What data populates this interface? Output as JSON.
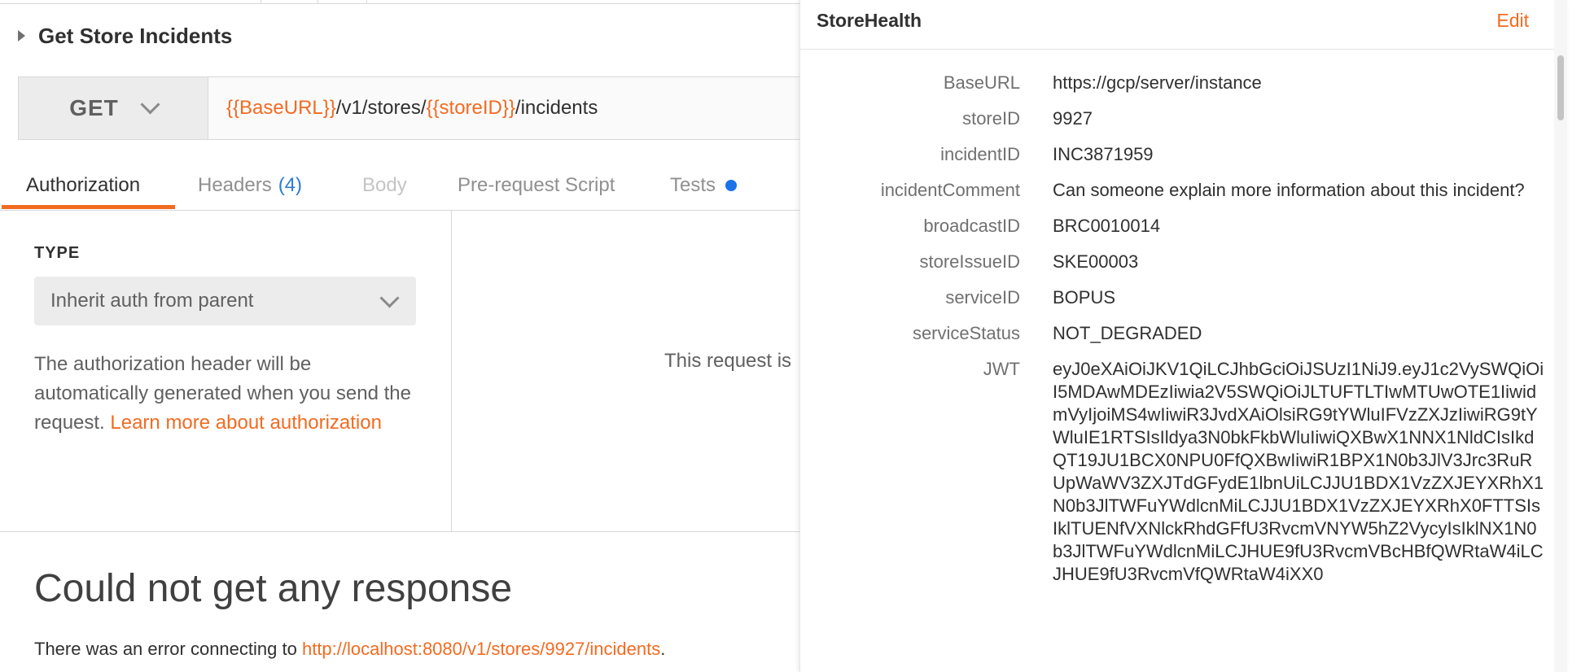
{
  "request": {
    "title": "Get Store Incidents",
    "method": "GET",
    "url_parts": {
      "var1": "{{BaseURL}}",
      "mid": "/v1/stores/",
      "var2": "{{storeID}}",
      "tail": "/incidents"
    }
  },
  "tabs": {
    "authorization": "Authorization",
    "headers": "Headers",
    "headers_count": "(4)",
    "body": "Body",
    "prerequest": "Pre-request Script",
    "tests": "Tests"
  },
  "auth": {
    "type_label": "TYPE",
    "type_value": "Inherit auth from parent",
    "description": "The authorization header will be automatically generated when you send the request.",
    "learn_more": "Learn more about authorization",
    "inherit_message": "This request is"
  },
  "response": {
    "heading": "Could not get any response",
    "error_prefix": "There was an error connecting to",
    "error_url": "http://localhost:8080/v1/stores/9927/incidents",
    "error_suffix": "."
  },
  "environment": {
    "name": "StoreHealth",
    "edit_label": "Edit",
    "variables": [
      {
        "key": "BaseURL",
        "value": "https://gcp/server/instance"
      },
      {
        "key": "storeID",
        "value": "9927"
      },
      {
        "key": "incidentID",
        "value": "INC3871959"
      },
      {
        "key": "incidentComment",
        "value": "Can someone explain more information about this incident?"
      },
      {
        "key": "broadcastID",
        "value": "BRC0010014"
      },
      {
        "key": "storeIssueID",
        "value": "SKE00003"
      },
      {
        "key": "serviceID",
        "value": "BOPUS"
      },
      {
        "key": "serviceStatus",
        "value": "NOT_DEGRADED"
      },
      {
        "key": "JWT",
        "value": "eyJ0eXAiOiJKV1QiLCJhbGciOiJSUzI1NiJ9.eyJ1c2VySWQiOiI5MDAwMDEzIiwia2V5SWQiOiJLTUFTLTIwMTUwOTE1IiwidmVyIjoiMS4wIiwiR3JvdXAiOlsiRG9tYWluIFVzZXJzIiwiRG9tYWluIE1RTSIsIldya3N0bkFkbWluIiwiQXBwX1NNX1NldCIsIkdQT19JU1BCX0NPU0FfQXBwIiwiR1BPX1N0b3JlV3Jrc3RuRUpWaWV3ZXJTdGFydE1lbnUiLCJJU1BDX1VzZXJEYXRhX1N0b3JlTWFuYWdlcnMiLCJJU1BDX1VzZXJEYXRhX0FTTSIsIklTUENfVXNlckRhdGFfU3RvcmVNYW5hZ2VycyIsIklNX1N0b3JlTWFuYWdlcnMiLCJHUE9fU3RvcmVBcHBfQWRtaW4iLCJHUE9fU3RvcmVfQWRtaW4iXX0"
      }
    ]
  }
}
